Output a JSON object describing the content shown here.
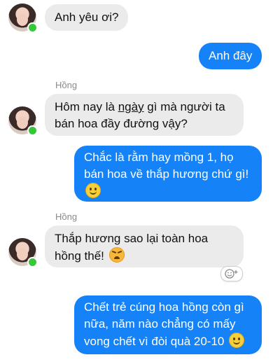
{
  "messages": [
    {
      "id": "m1",
      "direction": "incoming",
      "text": "Anh yêu ơi?"
    },
    {
      "id": "m2",
      "direction": "outgoing",
      "text": "Anh đây"
    },
    {
      "id": "m3",
      "direction": "incoming",
      "sender": "Hồng",
      "line1_pre": "Hôm nay là ",
      "line1_underlined": "ngày",
      "line1_post": " gì mà người ta",
      "line2": "bán hoa đầy đường vậy?"
    },
    {
      "id": "m4",
      "direction": "outgoing",
      "line1": "Chắc là rằm hay mồng 1, họ",
      "line2": "bán hoa về thắp hương chứ gì!",
      "emoji": "smiling-face"
    },
    {
      "id": "m5",
      "direction": "incoming",
      "sender": "Hồng",
      "line1": "Thắp hương sao lại toàn hoa",
      "line2": "hồng thế!",
      "emoji": "angry-face"
    },
    {
      "id": "m6",
      "direction": "outgoing",
      "line1": "Chết trẻ cúng hoa hồng còn gì",
      "line2": "nữa, năm nào chẳng có mấy",
      "line3": "vong chết vì đòi quà 20-10",
      "emoji": "smiling-face"
    }
  ],
  "colors": {
    "outgoing_bubble": "#1583f7",
    "incoming_bubble": "#ebebeb",
    "online": "#37c83a"
  },
  "icons": {
    "reaction": "add-reaction-icon"
  }
}
